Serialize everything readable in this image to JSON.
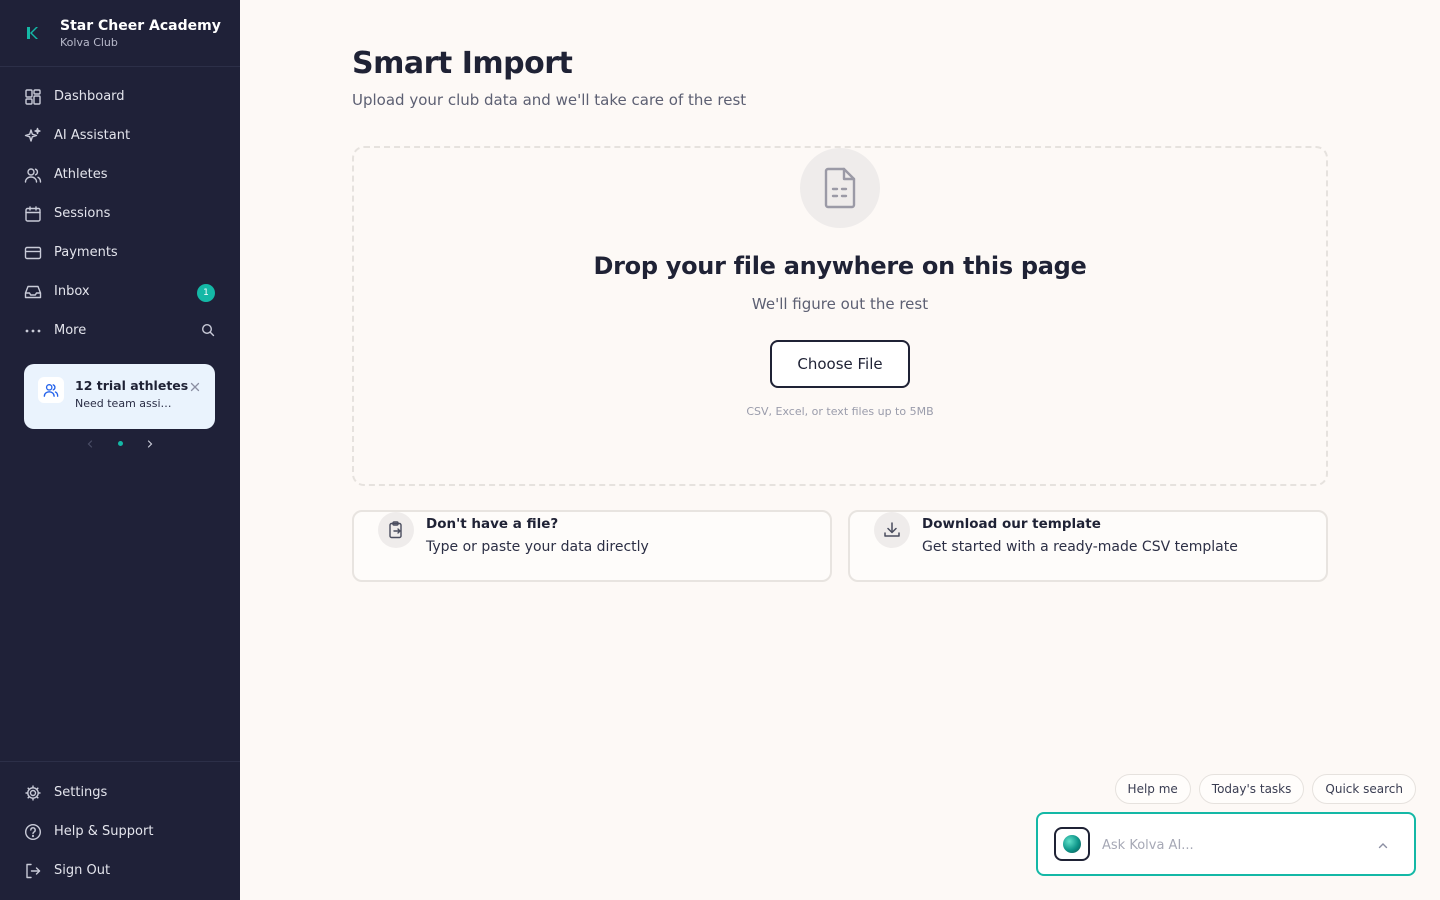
{
  "brand": {
    "name": "Star Cheer Academy",
    "subtitle": "Kolva Club"
  },
  "nav": [
    {
      "label": "Dashboard",
      "icon": "dashboard-icon"
    },
    {
      "label": "AI Assistant",
      "icon": "sparkles-icon"
    },
    {
      "label": "Athletes",
      "icon": "users-icon"
    },
    {
      "label": "Sessions",
      "icon": "calendar-icon"
    },
    {
      "label": "Payments",
      "icon": "credit-card-icon"
    },
    {
      "label": "Inbox",
      "icon": "inbox-icon",
      "badge": "1"
    },
    {
      "label": "More",
      "icon": "more-icon"
    }
  ],
  "promo": {
    "title": "12 trial athletes",
    "subtitle": "Need team assignments"
  },
  "bottom_nav": [
    {
      "label": "Settings",
      "icon": "gear-icon"
    },
    {
      "label": "Help & Support",
      "icon": "help-icon"
    },
    {
      "label": "Sign Out",
      "icon": "sign-out-icon"
    }
  ],
  "page": {
    "title": "Smart Import",
    "subtitle": "Upload your club data and we'll take care of the rest"
  },
  "dropzone": {
    "title": "Drop your file anywhere on this page",
    "subtitle": "We'll figure out the rest",
    "button": "Choose File",
    "hint": "CSV, Excel, or text files up to 5MB"
  },
  "options": [
    {
      "title": "Don't have a file?",
      "subtitle": "Type or paste your data directly",
      "icon": "clipboard-icon"
    },
    {
      "title": "Download our template",
      "subtitle": "Get started with a ready-made CSV template",
      "icon": "download-icon"
    }
  ],
  "chips": [
    "Help me",
    "Today's tasks",
    "Quick search"
  ],
  "ask": {
    "placeholder": "Ask Kolva AI..."
  },
  "colors": {
    "sidebar": "#1f2138",
    "accent": "#14b8a6",
    "background": "#fdf9f6",
    "promo": "#eaf3fd"
  }
}
